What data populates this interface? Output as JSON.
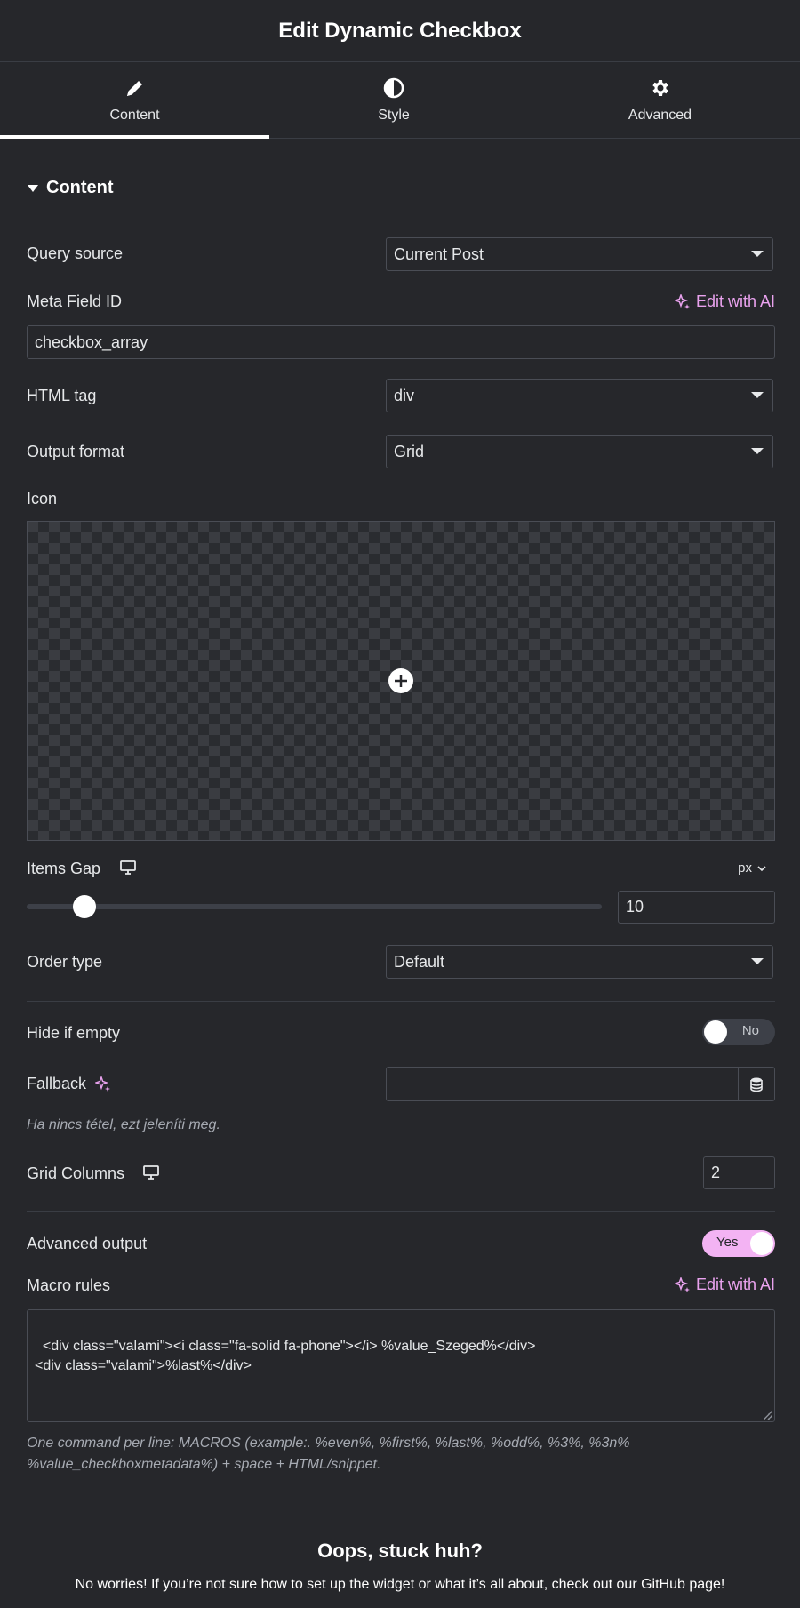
{
  "header": {
    "title": "Edit Dynamic Checkbox"
  },
  "tabs": [
    {
      "label": "Content",
      "icon": "pencil-icon",
      "active": true
    },
    {
      "label": "Style",
      "icon": "contrast-icon",
      "active": false
    },
    {
      "label": "Advanced",
      "icon": "gear-icon",
      "active": false
    }
  ],
  "section": {
    "title": "Content"
  },
  "fields": {
    "query_source": {
      "label": "Query source",
      "value": "Current Post"
    },
    "meta_field_id": {
      "label": "Meta Field ID",
      "ai_label": "Edit with AI",
      "value": "checkbox_array"
    },
    "html_tag": {
      "label": "HTML tag",
      "value": "div"
    },
    "output_format": {
      "label": "Output format",
      "value": "Grid"
    },
    "icon": {
      "label": "Icon"
    },
    "items_gap": {
      "label": "Items Gap",
      "unit": "px",
      "value": "10",
      "slider_fraction": 0.1
    },
    "order_type": {
      "label": "Order type",
      "value": "Default"
    },
    "hide_if_empty": {
      "label": "Hide if empty",
      "state": "No"
    },
    "fallback": {
      "label": "Fallback",
      "value": "",
      "hint": "Ha nincs tétel, ezt jeleníti meg."
    },
    "grid_columns": {
      "label": "Grid Columns",
      "value": "2"
    },
    "advanced_output": {
      "label": "Advanced output",
      "state": "Yes"
    },
    "macro_rules": {
      "label": "Macro rules",
      "ai_label": "Edit with AI",
      "value": "<div class=\"valami\"><i class=\"fa-solid fa-phone\"></i> %value_Szeged%</div>\n<div class=\"valami\">%last%</div>",
      "hint_line1": "One command per line: MACROS (example:. %even%, %first%, %last%, %odd%, %3%, %3n%",
      "hint_line2": "%value_checkboxmetadata%) + space + HTML/snippet."
    }
  },
  "footer": {
    "title": "Oops, stuck huh?",
    "text": "No worries! If you’re not sure how to set up the widget or what it’s all about, check out our GitHub page!"
  },
  "colors": {
    "accent": "#e9a2ee",
    "toggle_on": "#f3b3f3",
    "background": "#26272b"
  }
}
